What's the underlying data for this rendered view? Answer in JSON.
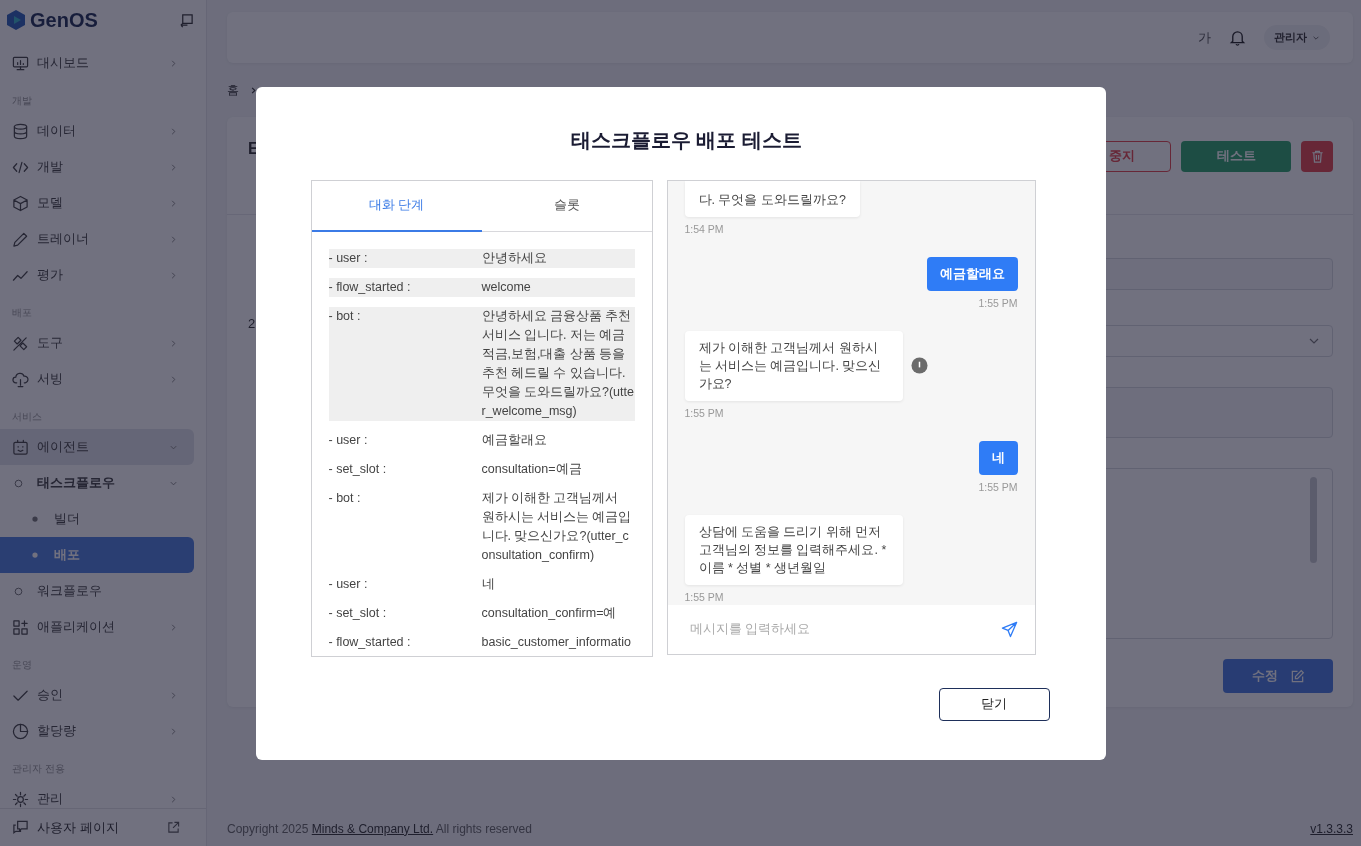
{
  "sidebar": {
    "logo": "GenOS",
    "entries": [
      {
        "kind": "item",
        "label": "대시보드",
        "expanded": false,
        "active": false,
        "selected": false
      },
      {
        "kind": "section",
        "label": "개발"
      },
      {
        "kind": "item",
        "label": "데이터",
        "expanded": false,
        "active": false,
        "selected": false
      },
      {
        "kind": "item",
        "label": "개발",
        "expanded": false,
        "active": false,
        "selected": false
      },
      {
        "kind": "item",
        "label": "모델",
        "expanded": false,
        "active": false,
        "selected": false
      },
      {
        "kind": "item",
        "label": "트레이너",
        "expanded": false,
        "active": false,
        "selected": false
      },
      {
        "kind": "item",
        "label": "평가",
        "expanded": false,
        "active": false,
        "selected": false
      },
      {
        "kind": "section",
        "label": "배포"
      },
      {
        "kind": "item",
        "label": "도구",
        "expanded": false,
        "active": false,
        "selected": false
      },
      {
        "kind": "item",
        "label": "서빙",
        "expanded": false,
        "active": false,
        "selected": false
      },
      {
        "kind": "section",
        "label": "서비스"
      },
      {
        "kind": "item",
        "label": "에이전트",
        "expanded": true,
        "active": true,
        "selected": false,
        "children": [
          {
            "label": "태스크플로우",
            "expanded": true,
            "active": true,
            "selected": false,
            "children": [
              {
                "label": "빌더",
                "selected": false
              },
              {
                "label": "배포",
                "selected": true
              }
            ]
          },
          {
            "label": "워크플로우",
            "active": false,
            "selected": false
          }
        ]
      },
      {
        "kind": "item",
        "label": "애플리케이션",
        "expanded": false,
        "active": false,
        "selected": false
      },
      {
        "kind": "section",
        "label": "운영"
      },
      {
        "kind": "item",
        "label": "승인",
        "expanded": false,
        "active": false,
        "selected": false
      },
      {
        "kind": "item",
        "label": "할당량",
        "expanded": false,
        "active": false,
        "selected": false
      },
      {
        "kind": "section",
        "label": "관리자 전용"
      },
      {
        "kind": "item",
        "label": "관리",
        "expanded": false,
        "active": false,
        "selected": false
      }
    ],
    "bottom_link": "사용자 페이지"
  },
  "header": {
    "font_toggle": "가",
    "user": "관리자"
  },
  "breadcrumb": [
    "홈"
  ],
  "page": {
    "title": "E",
    "info": [
      "2"
    ],
    "stop_button": "중지",
    "test_button": "테스트",
    "edit_button": "수정"
  },
  "modal": {
    "title": "태스크플로우 배포 테스트",
    "tabs": [
      {
        "label": "대화 단계",
        "selected": true
      },
      {
        "label": "슬롯",
        "selected": false
      }
    ],
    "steps": [
      {
        "label": "- user :",
        "value": "안녕하세요",
        "highlighted": true
      },
      {
        "label": "- flow_started :",
        "value": "welcome",
        "highlighted": true
      },
      {
        "label": "- bot :",
        "value": "안녕하세요 금융상품 추천 서비스 입니다. 저는 예금적금,보험,대출 상품 등을 추천 헤드릴 수 있습니다. 무엇을 도와드릴까요?(utter_welcome_msg)",
        "highlighted": true
      },
      {
        "label": "- user :",
        "value": "예금할래요",
        "highlighted": false
      },
      {
        "label": "- set_slot :",
        "value": "consultation=예금",
        "highlighted": false
      },
      {
        "label": "- bot :",
        "value": "제가 이해한 고객님께서 원하시는 서비스는 예금입니다. 맞으신가요?(utter_consultation_confirm)",
        "highlighted": false
      },
      {
        "label": "- user :",
        "value": "네",
        "highlighted": false
      },
      {
        "label": "- set_slot :",
        "value": "consultation_confirm=예",
        "highlighted": false
      },
      {
        "label": "- flow_started :",
        "value": "basic_customer_informatio",
        "highlighted": false
      }
    ],
    "chat": {
      "messages": [
        {
          "kind": "bot",
          "text": "다. 무엇을 도와드릴까요?",
          "time": "1:54 PM",
          "flagged": false
        },
        {
          "kind": "user",
          "text": "예금할래요",
          "time": "1:55 PM",
          "flagged": false
        },
        {
          "kind": "bot",
          "text": "제가 이해한 고객님께서 원하시는 서비스는 예금입니다. 맞으신가요?",
          "time": "1:55 PM",
          "flagged": true
        },
        {
          "kind": "user",
          "text": "네",
          "time": "1:55 PM",
          "flagged": false
        },
        {
          "kind": "bot",
          "text": "상담에 도움을 드리기 위해 먼저 고객님의 정보를 입력해주세요. * 이름 * 성별 * 생년월일",
          "time": "1:55 PM",
          "flagged": false
        }
      ],
      "placeholder": "메시지를 입력하세요"
    },
    "close_button": "닫기"
  },
  "footer": {
    "before": "Copyright 2025 ",
    "company": "Minds & Company Ltd.",
    "after": " All rights reserved",
    "version": "v1.3.3.3"
  }
}
